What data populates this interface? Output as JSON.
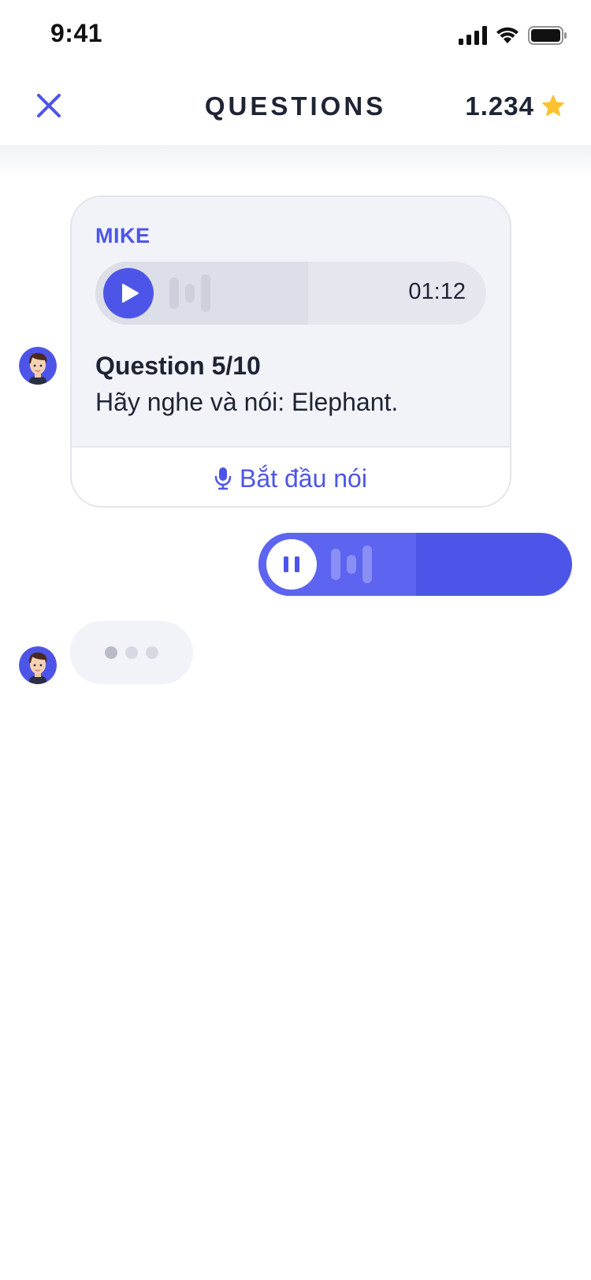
{
  "status_bar": {
    "time": "9:41",
    "icons": [
      "cellular-signal-icon",
      "wifi-icon",
      "battery-icon"
    ]
  },
  "header": {
    "close_icon": "close-icon",
    "title": "QUESTIONS",
    "score": "1.234",
    "score_icon": "star-icon"
  },
  "question_card": {
    "sender": "MIKE",
    "audio": {
      "duration": "01:12",
      "play_icon": "play-icon"
    },
    "question_label": "Question 5/10",
    "question_text": "Hãy nghe và nói: Elephant.",
    "action": {
      "icon": "microphone-icon",
      "label": "Bắt đầu nói"
    }
  },
  "voice_reply": {
    "pause_icon": "pause-icon"
  },
  "typing_indicator": {
    "dots": 3
  },
  "colors": {
    "accent": "#4D55E8",
    "card_bg": "#F2F3F8",
    "text_dark": "#1E2433",
    "star": "#FFC12E"
  }
}
